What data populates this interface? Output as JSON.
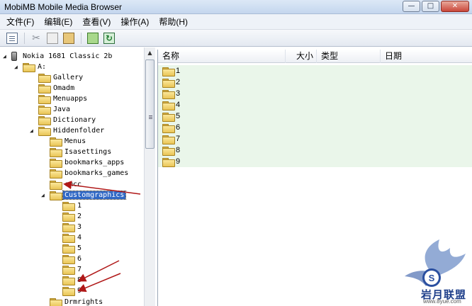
{
  "window": {
    "title": "MobiMB Mobile Media Browser",
    "controls": {
      "minimize": "—",
      "maximize": "□",
      "close": "✕"
    }
  },
  "menubar": {
    "items": [
      "文件(F)",
      "编辑(E)",
      "查看(V)",
      "操作(A)",
      "帮助(H)"
    ]
  },
  "toolbar": {
    "icons": [
      "properties-icon",
      "cut-icon",
      "copy-icon",
      "paste-icon",
      "up-folder-icon",
      "refresh-icon"
    ]
  },
  "tree": {
    "device": "Nokia 1681 Classic 2b",
    "drive": "A:",
    "nodes": [
      {
        "label": "Gallery"
      },
      {
        "label": "Omadm"
      },
      {
        "label": "Menuapps"
      },
      {
        "label": "Java"
      },
      {
        "label": "Dictionary"
      },
      {
        "label": "Hiddenfolder"
      },
      {
        "label": "Menus"
      },
      {
        "label": "Isasettings"
      },
      {
        "label": "bookmarks_apps"
      },
      {
        "label": "bookmarks_games"
      },
      {
        "label": "cmcc"
      },
      {
        "label": "Customgraphics",
        "selected": true
      },
      {
        "label": "1"
      },
      {
        "label": "2"
      },
      {
        "label": "3"
      },
      {
        "label": "4"
      },
      {
        "label": "5"
      },
      {
        "label": "6"
      },
      {
        "label": "7"
      },
      {
        "label": "8"
      },
      {
        "label": "9"
      },
      {
        "label": "Drmrights"
      }
    ]
  },
  "list": {
    "columns": [
      "名称",
      "大小",
      "类型",
      "日期"
    ],
    "rows": [
      {
        "name": "1"
      },
      {
        "name": "2"
      },
      {
        "name": "3"
      },
      {
        "name": "4"
      },
      {
        "name": "5"
      },
      {
        "name": "6"
      },
      {
        "name": "7"
      },
      {
        "name": "8"
      },
      {
        "name": "9"
      }
    ]
  },
  "watermark": {
    "text": "岩月联盟",
    "url": "www.8yue.com"
  },
  "colors": {
    "selection": "#3169c6",
    "list_fill": "#eaf6ea",
    "annotation": "#b01818"
  }
}
